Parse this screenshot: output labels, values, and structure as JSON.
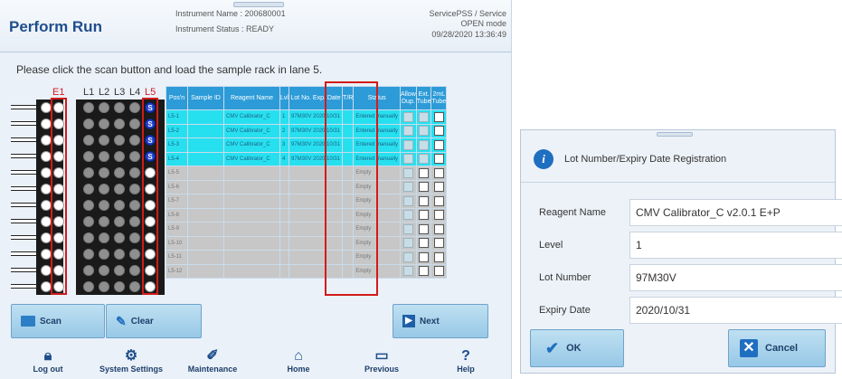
{
  "header": {
    "title": "Perform Run",
    "instrument_name": "Instrument Name : 200680001",
    "instrument_status": "Instrument Status : READY",
    "user": "ServicePSS / Service",
    "mode": "OPEN mode",
    "datetime": "09/28/2020 13:36:49"
  },
  "instruction": "Please click the scan button and load the sample rack in lane 5.",
  "lanes": [
    "E1",
    "L1",
    "L2",
    "L3",
    "L4",
    "L5"
  ],
  "slot_s_label": "S",
  "table": {
    "headers": [
      "Pos'n",
      "Sample ID",
      "Reagent Name",
      "Lvl",
      "Lot No.\nExp. Date",
      "T/R",
      "Status",
      "Allow Dup.",
      "Ext. Tube",
      "2mL Tube"
    ],
    "rows": [
      {
        "pos": "L5-1",
        "sample_id": "",
        "reagent": "CMV Calibrator_C",
        "lvl": "1",
        "lot": "97M30V 2020/10/31",
        "tr": "",
        "status": "Entered manually"
      },
      {
        "pos": "L5-2",
        "sample_id": "",
        "reagent": "CMV Calibrator_C",
        "lvl": "2",
        "lot": "97M30V 2020/10/31",
        "tr": "",
        "status": "Entered manually"
      },
      {
        "pos": "L5-3",
        "sample_id": "",
        "reagent": "CMV Calibrator_C",
        "lvl": "3",
        "lot": "97M30V 2020/10/31",
        "tr": "",
        "status": "Entered manually"
      },
      {
        "pos": "L5-4",
        "sample_id": "",
        "reagent": "CMV Calibrator_C",
        "lvl": "4",
        "lot": "97M30V 2020/10/31",
        "tr": "",
        "status": "Entered manually"
      },
      {
        "pos": "L5-5",
        "sample_id": "",
        "reagent": "",
        "lvl": "",
        "lot": "",
        "tr": "",
        "status": "Empty"
      },
      {
        "pos": "L5-6",
        "sample_id": "",
        "reagent": "",
        "lvl": "",
        "lot": "",
        "tr": "",
        "status": "Empty"
      },
      {
        "pos": "L5-7",
        "sample_id": "",
        "reagent": "",
        "lvl": "",
        "lot": "",
        "tr": "",
        "status": "Empty"
      },
      {
        "pos": "L5-8",
        "sample_id": "",
        "reagent": "",
        "lvl": "",
        "lot": "",
        "tr": "",
        "status": "Empty"
      },
      {
        "pos": "L5-9",
        "sample_id": "",
        "reagent": "",
        "lvl": "",
        "lot": "",
        "tr": "",
        "status": "Empty"
      },
      {
        "pos": "L5-10",
        "sample_id": "",
        "reagent": "",
        "lvl": "",
        "lot": "",
        "tr": "",
        "status": "Empty"
      },
      {
        "pos": "L5-11",
        "sample_id": "",
        "reagent": "",
        "lvl": "",
        "lot": "",
        "tr": "",
        "status": "Empty"
      },
      {
        "pos": "L5-12",
        "sample_id": "",
        "reagent": "",
        "lvl": "",
        "lot": "",
        "tr": "",
        "status": "Empty"
      }
    ]
  },
  "buttons": {
    "scan": "Scan",
    "clear": "Clear",
    "next": "Next"
  },
  "footer": [
    "Log out",
    "System Settings",
    "Maintenance",
    "Home",
    "Previous",
    "Help"
  ],
  "footer_icons": [
    "lock-icon",
    "gear-icon",
    "wrench-icon",
    "home-icon",
    "previous-icon",
    "help-icon"
  ],
  "dialog": {
    "title": "Lot Number/Expiry Date Registration",
    "fields": [
      {
        "label": "Reagent Name",
        "value": "CMV Calibrator_C v2.0.1 E+P"
      },
      {
        "label": "Level",
        "value": "1"
      },
      {
        "label": "Lot Number",
        "value": "97M30V"
      },
      {
        "label": "Expiry Date",
        "value": "2020/10/31"
      }
    ],
    "ok_label": "OK",
    "cancel_label": "Cancel"
  },
  "colors": {
    "accent": "#2c9bd8",
    "highlight": "#27e0ef",
    "alert_red": "#d21b1b",
    "title": "#1f4e8c"
  }
}
